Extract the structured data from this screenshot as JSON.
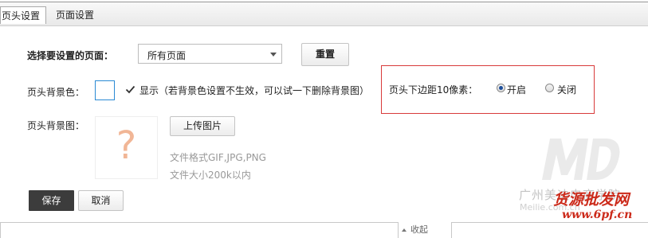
{
  "tabs": [
    {
      "label": "页头设置",
      "active": true
    },
    {
      "label": "页面设置",
      "active": false
    }
  ],
  "page_select": {
    "label": "选择要设置的页面：",
    "value": "所有页面"
  },
  "reset_button": "重置",
  "bg_color": {
    "label": "页头背景色：",
    "swatch_color": "#ffffff",
    "checkbox_checked": true,
    "checkbox_label": "显示（若背景色设置不生效，可以试一下删除背景图）"
  },
  "bottom_margin": {
    "label": "页头下边距10像素：",
    "options": [
      {
        "label": "开启",
        "selected": true
      },
      {
        "label": "关闭",
        "selected": false
      }
    ]
  },
  "bg_image": {
    "label": "页头背景图：",
    "placeholder_glyph": "?",
    "upload_button": "上传图片",
    "format_hint": "文件格式GIF,JPG,PNG",
    "size_hint": "文件大小200k以内"
  },
  "actions": {
    "save": "保存",
    "cancel": "取消"
  },
  "collapse_label": "收起",
  "watermark": {
    "company": "广州美迪电商学院",
    "site": "Meilie.com.cn",
    "wholesale": "货源批发网",
    "wholesale_url": "www.6pf.cn"
  },
  "colors": {
    "highlight_border": "#d83a3a",
    "accent_blue": "#2a8ad4",
    "save_bg": "#3c3c3c",
    "watermark_red": "#cc2a1a"
  }
}
